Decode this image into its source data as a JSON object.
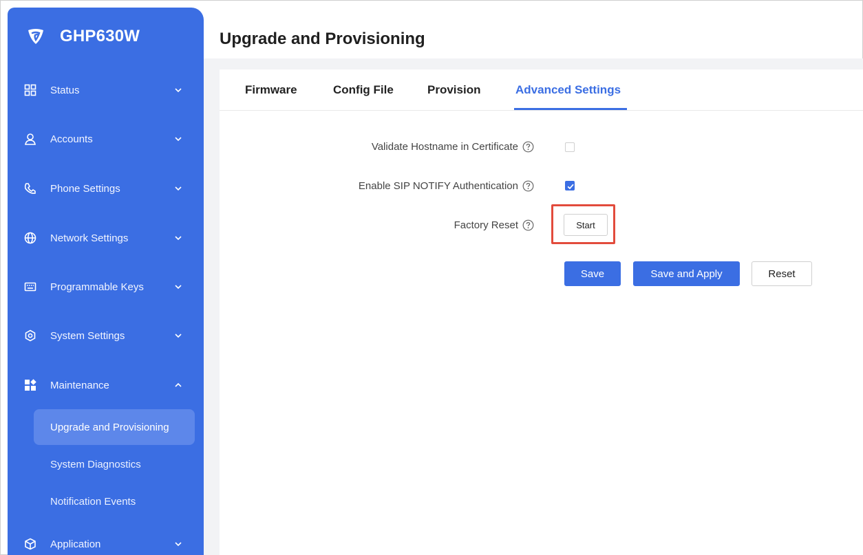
{
  "brand": {
    "title": "GHP630W"
  },
  "sidebar": {
    "items": [
      {
        "label": "Status",
        "icon": "status-grid-icon",
        "chevron": "down"
      },
      {
        "label": "Accounts",
        "icon": "user-icon",
        "chevron": "down"
      },
      {
        "label": "Phone Settings",
        "icon": "phone-icon",
        "chevron": "down"
      },
      {
        "label": "Network Settings",
        "icon": "globe-icon",
        "chevron": "down"
      },
      {
        "label": "Programmable Keys",
        "icon": "keyboard-icon",
        "chevron": "down"
      },
      {
        "label": "System Settings",
        "icon": "gear-icon",
        "chevron": "down"
      },
      {
        "label": "Maintenance",
        "icon": "maintenance-icon",
        "chevron": "up"
      },
      {
        "label": "Application",
        "icon": "application-icon",
        "chevron": "down"
      }
    ],
    "subitems": [
      {
        "label": "Upgrade and Provisioning",
        "active": true
      },
      {
        "label": "System Diagnostics",
        "active": false
      },
      {
        "label": "Notification Events",
        "active": false
      }
    ]
  },
  "page": {
    "title": "Upgrade and Provisioning"
  },
  "tabs": [
    {
      "label": "Firmware",
      "active": false
    },
    {
      "label": "Config File",
      "active": false
    },
    {
      "label": "Provision",
      "active": false
    },
    {
      "label": "Advanced Settings",
      "active": true
    }
  ],
  "form": {
    "validate_hostname": {
      "label": "Validate Hostname in Certificate",
      "checked": false
    },
    "sip_notify": {
      "label": "Enable SIP NOTIFY Authentication",
      "checked": true
    },
    "factory_reset": {
      "label": "Factory Reset",
      "button": "Start"
    }
  },
  "actions": {
    "save": "Save",
    "save_apply": "Save and Apply",
    "reset": "Reset"
  },
  "colors": {
    "accent": "#3b6ee3",
    "highlight": "#e24b3c",
    "sidebar_active": "#5d87ea"
  }
}
